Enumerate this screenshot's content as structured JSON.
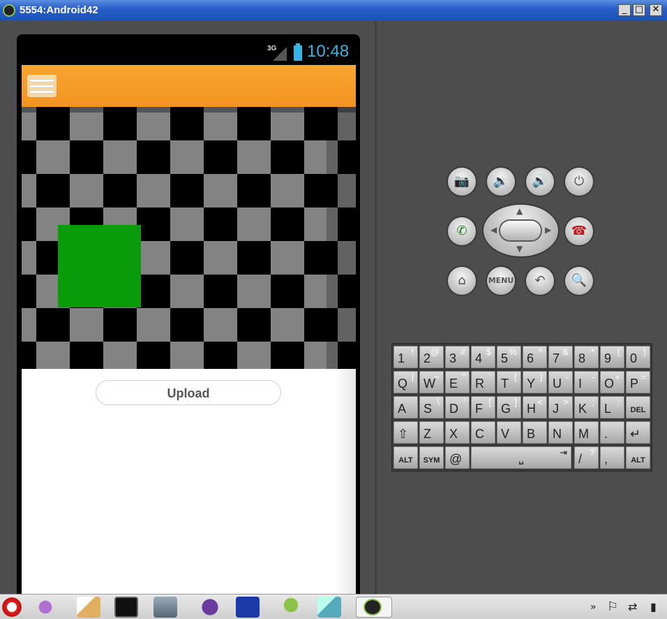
{
  "window": {
    "title": "5554:Android42",
    "minimize": "_",
    "maximize": "□",
    "close": "✕"
  },
  "status_bar": {
    "network": "3G",
    "time": "10:48"
  },
  "action_bar": {
    "menu_icon": "hamburger-menu-icon"
  },
  "content": {
    "upload_label": "Upload"
  },
  "hardware_buttons": {
    "camera": "📷",
    "volume_down": "🔉",
    "volume_up": "🔊",
    "power": "⏻",
    "call": "✆",
    "end_call": "☎",
    "home": "⌂",
    "menu": "MENU",
    "back": "↶",
    "search": "🔍"
  },
  "keyboard": {
    "row1": [
      {
        "main": "1",
        "alt": "!"
      },
      {
        "main": "2",
        "alt": "@"
      },
      {
        "main": "3",
        "alt": "#"
      },
      {
        "main": "4",
        "alt": "$"
      },
      {
        "main": "5",
        "alt": "%"
      },
      {
        "main": "6",
        "alt": "^"
      },
      {
        "main": "7",
        "alt": "&"
      },
      {
        "main": "8",
        "alt": "*"
      },
      {
        "main": "9",
        "alt": "("
      },
      {
        "main": "0",
        "alt": ")"
      }
    ],
    "row2": [
      {
        "main": "Q",
        "alt": "|"
      },
      {
        "main": "W",
        "alt": "~"
      },
      {
        "main": "E",
        "alt": "\""
      },
      {
        "main": "R",
        "alt": "`"
      },
      {
        "main": "T",
        "alt": "{"
      },
      {
        "main": "Y",
        "alt": "}"
      },
      {
        "main": "U",
        "alt": "-"
      },
      {
        "main": "I",
        "alt": "-"
      },
      {
        "main": "O",
        "alt": "+"
      },
      {
        "main": "P",
        "alt": "="
      }
    ],
    "row3": [
      {
        "main": "A",
        "alt": ""
      },
      {
        "main": "S",
        "alt": "\\"
      },
      {
        "main": "D",
        "alt": "'"
      },
      {
        "main": "F",
        "alt": "["
      },
      {
        "main": "G",
        "alt": "]"
      },
      {
        "main": "H",
        "alt": "<"
      },
      {
        "main": "J",
        "alt": ">"
      },
      {
        "main": "K",
        "alt": ";"
      },
      {
        "main": "L",
        "alt": ":"
      },
      {
        "main": "DEL",
        "alt": ""
      }
    ],
    "row4": [
      {
        "main": "⇧",
        "alt": ""
      },
      {
        "main": "Z",
        "alt": ""
      },
      {
        "main": "X",
        "alt": ""
      },
      {
        "main": "C",
        "alt": ""
      },
      {
        "main": "V",
        "alt": ""
      },
      {
        "main": "B",
        "alt": ""
      },
      {
        "main": "N",
        "alt": ""
      },
      {
        "main": "M",
        "alt": ""
      },
      {
        "main": ".",
        "alt": ""
      },
      {
        "main": "↵",
        "alt": ""
      }
    ],
    "row5": {
      "alt_left": "ALT",
      "sym": "SYM",
      "at": "@",
      "space": "␣",
      "tab": "⇥",
      "slash": "/",
      "question": "?",
      "comma": ",",
      "alt_right": "ALT"
    }
  },
  "taskbar": {
    "apps": [
      "opera-icon",
      "pidgin-icon",
      "notepad-icon",
      "cmd-icon",
      "network-icon",
      "eclipse-icon",
      "web-icon",
      "android-sdk-icon",
      "notes-icon",
      "android-emulator-icon"
    ],
    "tray": {
      "chevron": "»",
      "flag": "⚐",
      "sync": "⇄",
      "signal": "▮"
    }
  }
}
